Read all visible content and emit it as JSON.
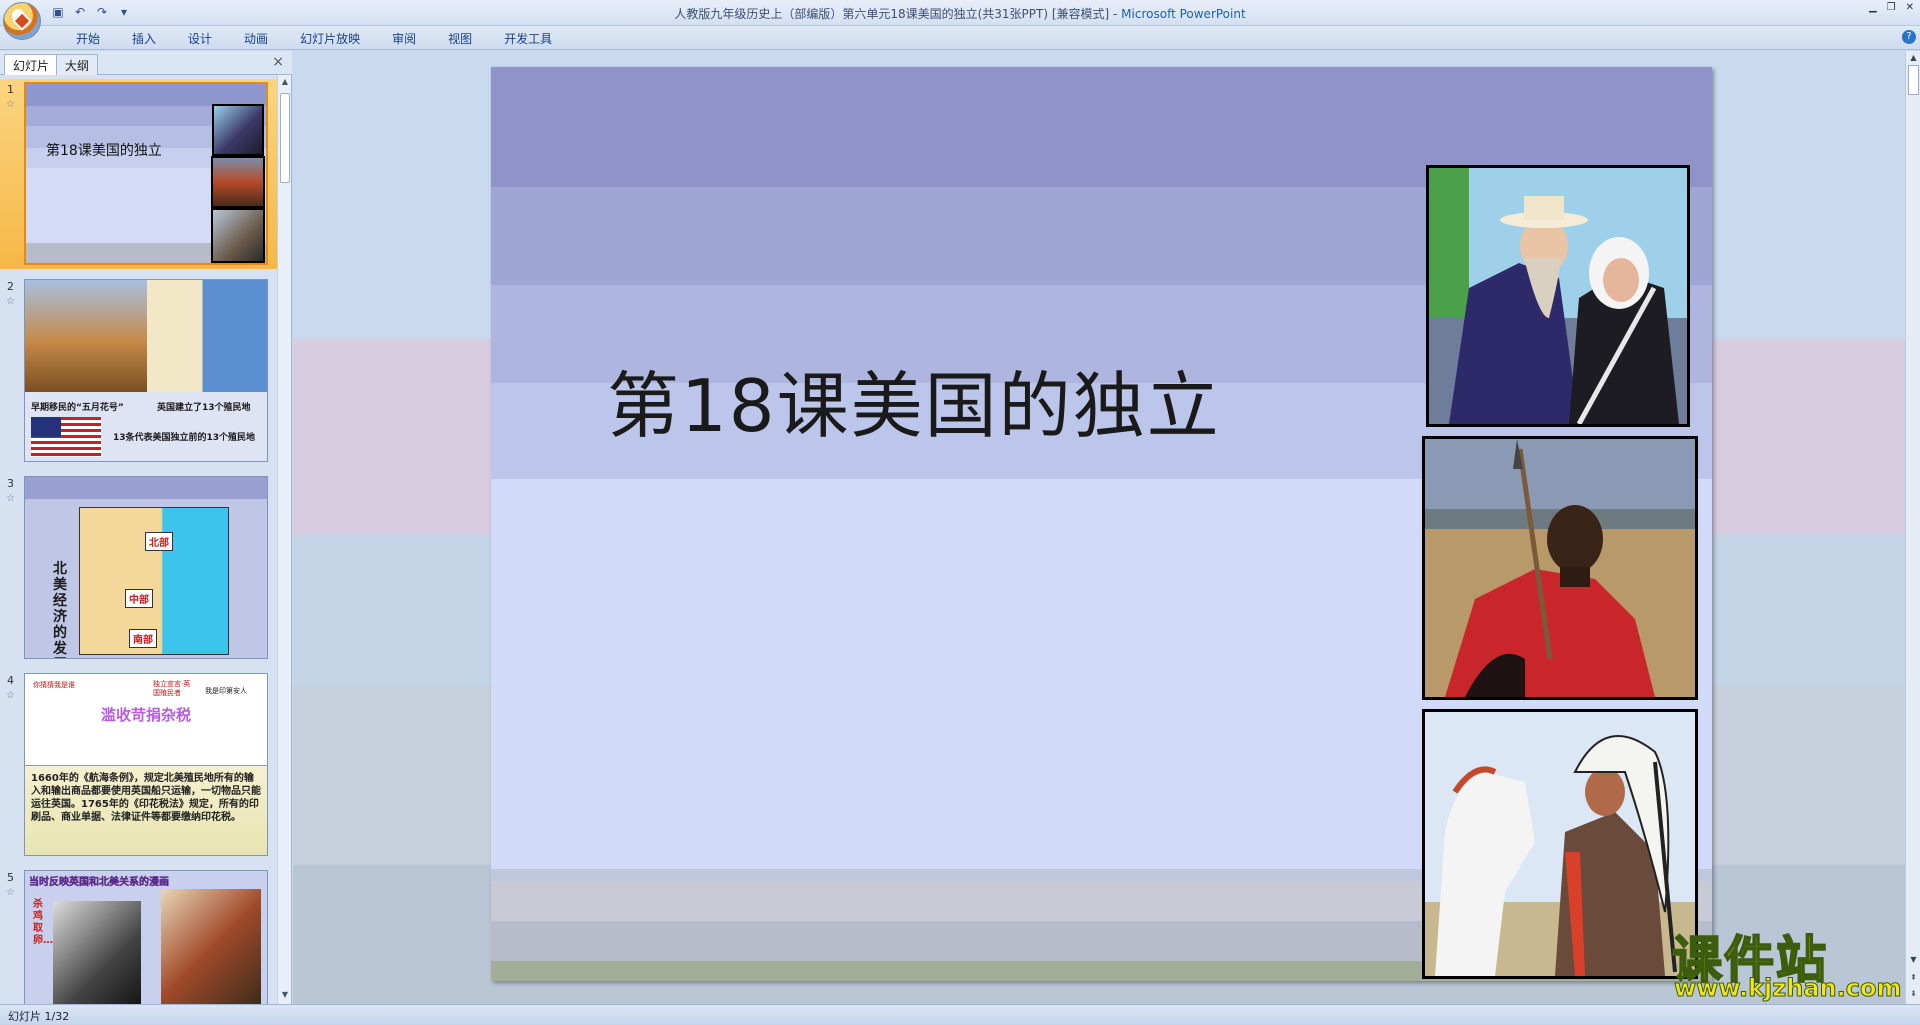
{
  "window": {
    "title_doc": "人教版九年级历史上（部编版）第六单元18课美国的独立(共31张PPT) [兼容模式]",
    "title_sep": " - ",
    "title_app": "Microsoft PowerPoint"
  },
  "ribbon": {
    "tabs": [
      "开始",
      "插入",
      "设计",
      "动画",
      "幻灯片放映",
      "审阅",
      "视图",
      "开发工具"
    ]
  },
  "left_panel": {
    "tab_slides": "幻灯片",
    "tab_outline": "大纲",
    "close": "×",
    "thumbnails": [
      {
        "num": "1",
        "star": "☆",
        "selected": true
      },
      {
        "num": "2",
        "star": "☆"
      },
      {
        "num": "3",
        "star": "☆"
      },
      {
        "num": "4",
        "star": "☆"
      },
      {
        "num": "5",
        "star": "☆"
      }
    ],
    "thumb1_title": "第18课美国的独立",
    "thumb2": {
      "caption1": "早期移民的“五月花号”",
      "caption2": "英国建立了13个殖民地",
      "caption3": "13条代表美国独立前的13个殖民地"
    },
    "thumb3": {
      "vertical_title": "北美经济的发展",
      "north": "北部",
      "middle": "中部",
      "south": "南部"
    },
    "thumb4": {
      "bubble_left": "你猜猜我是谁",
      "bubble_mid": "独立宣言·英国殖民者",
      "bubble_right": "我是印第安人",
      "banner": "滥收苛捐杂税",
      "text": "1660年的《航海条例》，规定北美殖民地所有的输入和输出商品都要使用英国船只运输，一切物品只能运往英国。1765年的《印花税法》规定，所有的印刷品、商业单据、法律证件等都要缴纳印花税。"
    },
    "thumb5": {
      "title": "当时反映英国和北美关系的漫画",
      "side": "杀鸡取卵…"
    }
  },
  "slide": {
    "title": "第18课美国的独立"
  },
  "status": {
    "text": "幻灯片 1/32"
  },
  "watermark": {
    "big": "课件站",
    "small": "www.kjzhan.com"
  }
}
